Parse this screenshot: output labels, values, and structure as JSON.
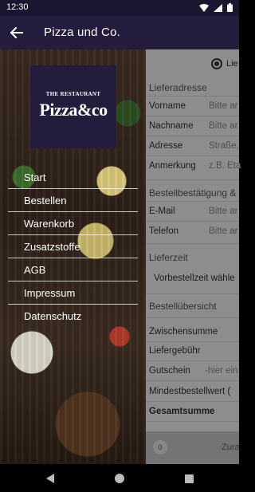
{
  "status": {
    "time": "12:30"
  },
  "appbar": {
    "title": "Pizza und Co."
  },
  "logo": {
    "tagline": "THE RESTAURANT",
    "name": "Pizza&co"
  },
  "menu": [
    {
      "label": "Start"
    },
    {
      "label": "Bestellen"
    },
    {
      "label": "Warenkorb"
    },
    {
      "label": "Zusatzstoffe"
    },
    {
      "label": "AGB"
    },
    {
      "label": "Impressum"
    },
    {
      "label": "Datenschutz"
    }
  ],
  "form": {
    "delivery_radio_label": "Lie",
    "address_section": "Lieferadresse",
    "vorname_label": "Vorname",
    "vorname_placeholder": "Bitte ar",
    "nachname_label": "Nachname",
    "nachname_placeholder": "Bitte ar",
    "adresse_label": "Adresse",
    "adresse_placeholder": "Straße,",
    "anmerkung_label": "Anmerkung",
    "anmerkung_placeholder": "z.B. Eta",
    "confirm_section": "Bestellbestätigung &",
    "email_label": "E-Mail",
    "email_placeholder": "Bitte ar",
    "telefon_label": "Telefon",
    "telefon_placeholder": "Bitte ar",
    "time_section": "Lieferzeit",
    "time_value": "Vorbestellzeit wähle",
    "overview_section": "Bestellübersicht",
    "subtotal_label": "Zwischensumme",
    "fee_label": "Liefergebühr",
    "voucher_label": "Gutschein",
    "voucher_placeholder": "-hier ein",
    "min_order_label": "Mindestbestellwert (",
    "total_label": "Gesamtsumme",
    "cart_count": "0",
    "pay_label": "Zura"
  }
}
